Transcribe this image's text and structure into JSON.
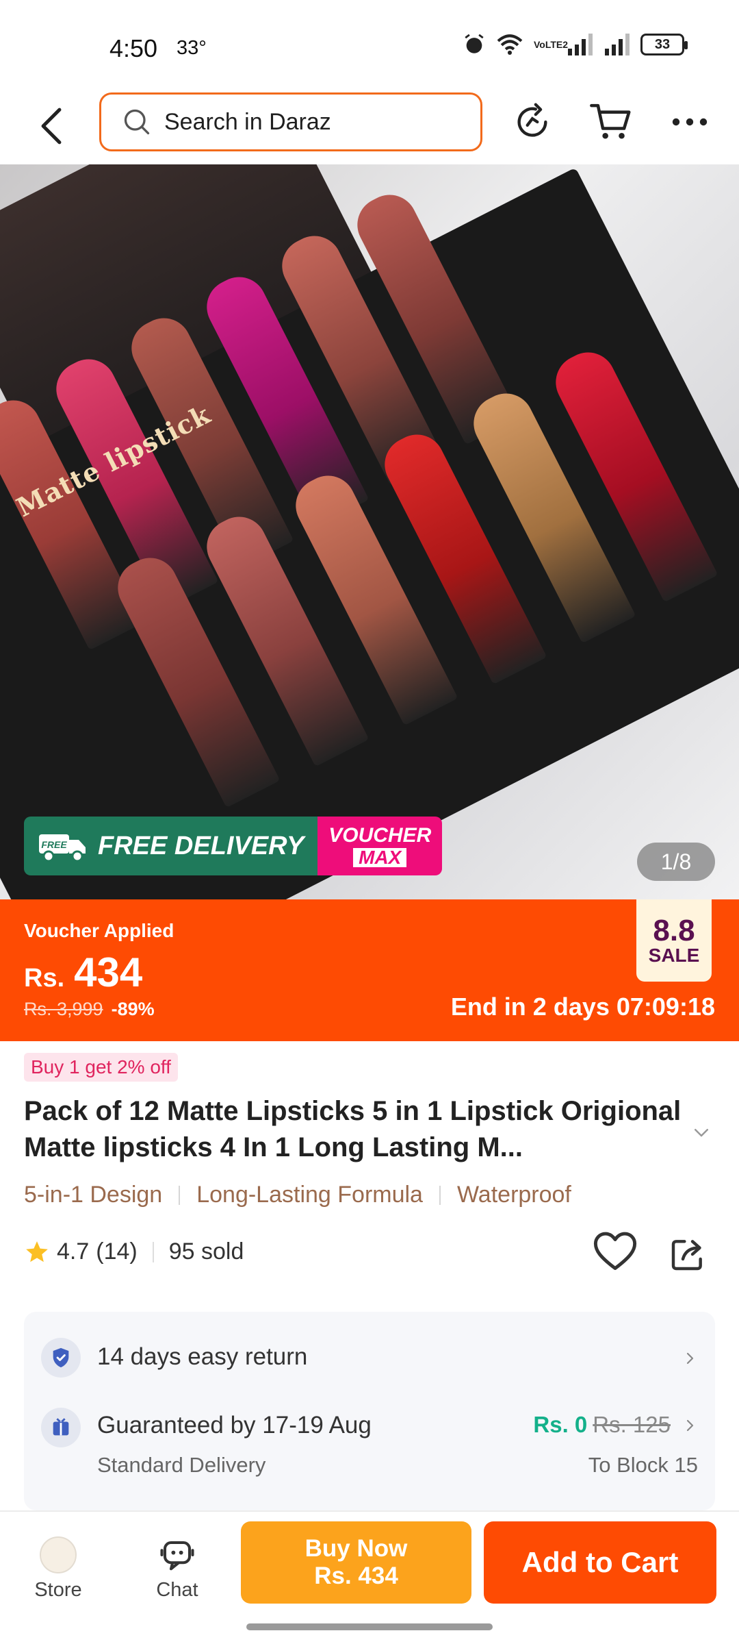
{
  "status_bar": {
    "time": "4:50",
    "temperature": "33°",
    "battery": "33",
    "network_label": "VoLTE2"
  },
  "header": {
    "search_placeholder": "Search in Daraz",
    "icons": [
      "back-arrow-icon",
      "search-icon",
      "share-refresh-icon",
      "cart-icon",
      "more-icon"
    ]
  },
  "hero": {
    "box_text": "Matte lipstick",
    "free_delivery": "FREE DELIVERY",
    "free_truck_label": "FREE",
    "voucher_top": "VOUCHER",
    "voucher_bottom": "MAX",
    "page_indicator": "1/8"
  },
  "price": {
    "voucher_applied": "Voucher Applied",
    "currency": "Rs.",
    "amount": "434",
    "original": "Rs. 3,999",
    "discount": "-89%",
    "countdown": "End in 2 days 07:09:18",
    "sale_tag_top": "8.8",
    "sale_tag_bottom": "SALE"
  },
  "product": {
    "promo": "Buy 1 get 2% off",
    "title": "Pack of 12 Matte Lipsticks 5 in 1 Lipstick Origional Matte lipsticks 4 In 1 Long Lasting M...",
    "features": [
      "5-in-1 Design",
      "Long-Lasting Formula",
      "Waterproof"
    ],
    "rating": "4.7",
    "reviews": "(14)",
    "sold": "95 sold"
  },
  "services": {
    "return": "14 days easy return",
    "delivery_title": "Guaranteed by 17-19 Aug",
    "delivery_sub": "Standard Delivery",
    "shipping_fee": "Rs. 0",
    "shipping_old": "Rs. 125",
    "destination": "To Block 15"
  },
  "bottom_bar": {
    "store": "Store",
    "chat": "Chat",
    "buy_now": "Buy Now",
    "buy_now_price": "Rs. 434",
    "add_to_cart": "Add to Cart"
  },
  "colors": {
    "brand_orange": "#fe4b03",
    "buy_now_yellow": "#fca31c",
    "free_delivery_green": "#1f7a5b",
    "voucher_pink": "#ee0d7a",
    "shipping_free_green": "#14b08a",
    "feature_brown": "#9a6a4d"
  }
}
